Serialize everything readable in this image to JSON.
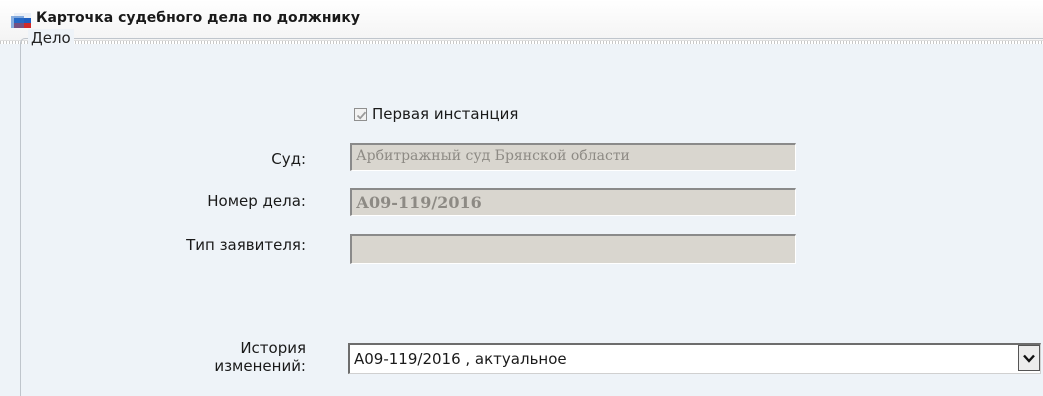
{
  "window": {
    "title": "Карточка судебного дела по должнику",
    "icon": "app-flag-icon"
  },
  "case_group": {
    "legend": "Дело",
    "first_instance": {
      "label": "Первая инстанция",
      "checked": true
    },
    "fields": {
      "court": {
        "label": "Суд:",
        "value": "Арбитражный суд Брянской области"
      },
      "case_number": {
        "label": "Номер дела:",
        "value": "А09-119/2016"
      },
      "applicant_type": {
        "label": "Тип заявителя:",
        "value": ""
      }
    },
    "history": {
      "label_line1": "История",
      "label_line2": "изменений:",
      "selected": "А09-119/2016 , актуальное",
      "dropdown_icon": "chevron-down-icon"
    }
  },
  "colors": {
    "panel_background": "#eef3f8",
    "readonly_field": "#d9d6cf",
    "readonly_text": "#8d8a84"
  }
}
